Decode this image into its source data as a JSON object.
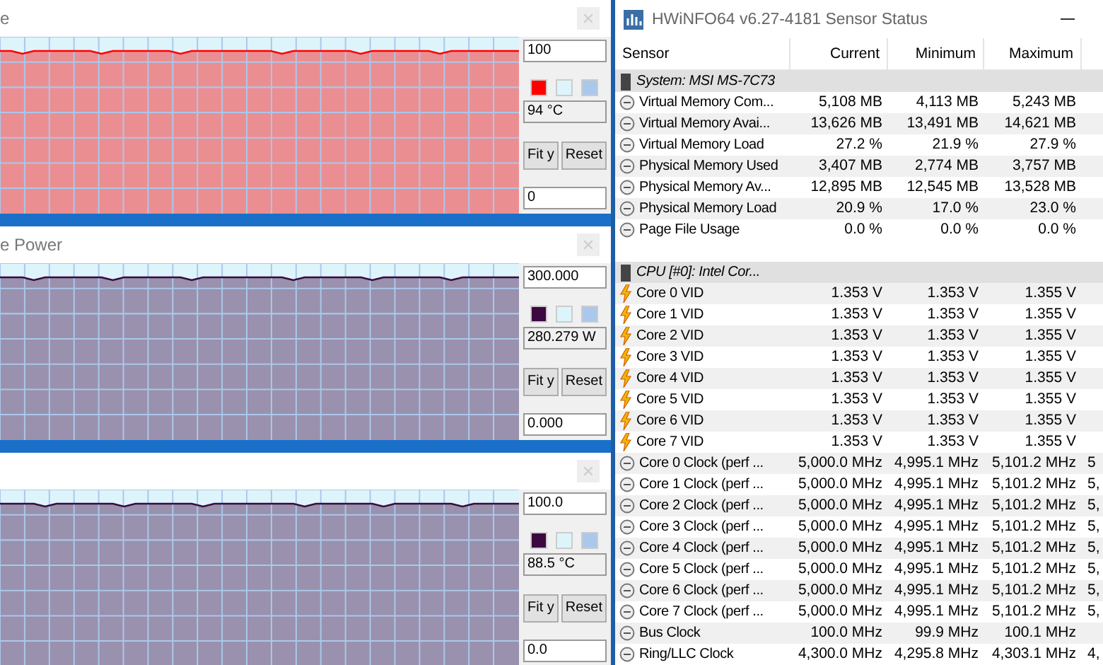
{
  "graph_windows": [
    {
      "title": "e",
      "max": "100",
      "current": "94 °C",
      "min": "0",
      "swatches": [
        {
          "color": "#ff0000"
        },
        {
          "color": "#ddf4fb"
        },
        {
          "color": "#aac8ec"
        }
      ],
      "buttons": [
        "Fit y",
        "Reset"
      ]
    },
    {
      "title": "e Power",
      "max": "300.000",
      "current": "280.279 W",
      "min": "0.000",
      "swatches": [
        {
          "color": "#3c0840"
        },
        {
          "color": "#ddf4fb"
        },
        {
          "color": "#aac8ec"
        }
      ],
      "buttons": [
        "Fit y",
        "Reset"
      ]
    },
    {
      "max": "100.0",
      "current": "88.5 °C",
      "min": "0.0",
      "swatches": [
        {
          "color": "#3c0840"
        },
        {
          "color": "#ddf4fb"
        },
        {
          "color": "#aac8ec"
        }
      ],
      "buttons": [
        "Fit y",
        "Reset"
      ]
    }
  ],
  "sensor_window": {
    "title": "HWiNFO64 v6.27-4181 Sensor Status",
    "columns": [
      "Sensor",
      "Current",
      "Minimum",
      "Maximum"
    ],
    "rows": [
      {
        "kind": "group",
        "name": "System: MSI MS-7C73"
      },
      {
        "kind": "gauge",
        "name": "Virtual Memory Com...",
        "current": "5,108 MB",
        "minimum": "4,113 MB",
        "maximum": "5,243 MB"
      },
      {
        "kind": "gauge",
        "name": "Virtual Memory Avai...",
        "current": "13,626 MB",
        "minimum": "13,491 MB",
        "maximum": "14,621 MB"
      },
      {
        "kind": "gauge",
        "name": "Virtual Memory Load",
        "current": "27.2 %",
        "minimum": "21.9 %",
        "maximum": "27.9 %"
      },
      {
        "kind": "gauge",
        "name": "Physical Memory Used",
        "current": "3,407 MB",
        "minimum": "2,774 MB",
        "maximum": "3,757 MB"
      },
      {
        "kind": "gauge",
        "name": "Physical Memory Av...",
        "current": "12,895 MB",
        "minimum": "12,545 MB",
        "maximum": "13,528 MB"
      },
      {
        "kind": "gauge",
        "name": "Physical Memory Load",
        "current": "20.9 %",
        "minimum": "17.0 %",
        "maximum": "23.0 %"
      },
      {
        "kind": "gauge",
        "name": "Page File Usage",
        "current": "0.0 %",
        "minimum": "0.0 %",
        "maximum": "0.0 %"
      },
      {
        "kind": "blank"
      },
      {
        "kind": "group",
        "name": "CPU [#0]: Intel Cor..."
      },
      {
        "kind": "voltage",
        "name": "Core 0 VID",
        "current": "1.353 V",
        "minimum": "1.353 V",
        "maximum": "1.355 V"
      },
      {
        "kind": "voltage",
        "name": "Core 1 VID",
        "current": "1.353 V",
        "minimum": "1.353 V",
        "maximum": "1.355 V"
      },
      {
        "kind": "voltage",
        "name": "Core 2 VID",
        "current": "1.353 V",
        "minimum": "1.353 V",
        "maximum": "1.355 V"
      },
      {
        "kind": "voltage",
        "name": "Core 3 VID",
        "current": "1.353 V",
        "minimum": "1.353 V",
        "maximum": "1.355 V"
      },
      {
        "kind": "voltage",
        "name": "Core 4 VID",
        "current": "1.353 V",
        "minimum": "1.353 V",
        "maximum": "1.355 V"
      },
      {
        "kind": "voltage",
        "name": "Core 5 VID",
        "current": "1.353 V",
        "minimum": "1.353 V",
        "maximum": "1.355 V"
      },
      {
        "kind": "voltage",
        "name": "Core 6 VID",
        "current": "1.353 V",
        "minimum": "1.353 V",
        "maximum": "1.355 V"
      },
      {
        "kind": "voltage",
        "name": "Core 7 VID",
        "current": "1.353 V",
        "minimum": "1.353 V",
        "maximum": "1.355 V"
      },
      {
        "kind": "gauge",
        "name": "Core 0 Clock (perf ...",
        "current": "5,000.0 MHz",
        "minimum": "4,995.1 MHz",
        "maximum": "5,101.2 MHz",
        "column_5": "5"
      },
      {
        "kind": "gauge",
        "name": "Core 1 Clock (perf ...",
        "current": "5,000.0 MHz",
        "minimum": "4,995.1 MHz",
        "maximum": "5,101.2 MHz",
        "column_5": "5,"
      },
      {
        "kind": "gauge",
        "name": "Core 2 Clock (perf ...",
        "current": "5,000.0 MHz",
        "minimum": "4,995.1 MHz",
        "maximum": "5,101.2 MHz",
        "column_5": "5,"
      },
      {
        "kind": "gauge",
        "name": "Core 3 Clock (perf ...",
        "current": "5,000.0 MHz",
        "minimum": "4,995.1 MHz",
        "maximum": "5,101.2 MHz",
        "column_5": "5,"
      },
      {
        "kind": "gauge",
        "name": "Core 4 Clock (perf ...",
        "current": "5,000.0 MHz",
        "minimum": "4,995.1 MHz",
        "maximum": "5,101.2 MHz",
        "column_5": "5,"
      },
      {
        "kind": "gauge",
        "name": "Core 5 Clock (perf ...",
        "current": "5,000.0 MHz",
        "minimum": "4,995.1 MHz",
        "maximum": "5,101.2 MHz",
        "column_5": "5,"
      },
      {
        "kind": "gauge",
        "name": "Core 6 Clock (perf ...",
        "current": "5,000.0 MHz",
        "minimum": "4,995.1 MHz",
        "maximum": "5,101.2 MHz",
        "column_5": "5,"
      },
      {
        "kind": "gauge",
        "name": "Core 7 Clock (perf ...",
        "current": "5,000.0 MHz",
        "minimum": "4,995.1 MHz",
        "maximum": "5,101.2 MHz",
        "column_5": "5,"
      },
      {
        "kind": "gauge",
        "name": "Bus Clock",
        "current": "100.0 MHz",
        "minimum": "99.9 MHz",
        "maximum": "100.1 MHz"
      },
      {
        "kind": "gauge",
        "name": "Ring/LLC Clock",
        "current": "4,300.0 MHz",
        "minimum": "4,295.8 MHz",
        "maximum": "4,303.1 MHz",
        "column_5": "4,"
      }
    ]
  }
}
